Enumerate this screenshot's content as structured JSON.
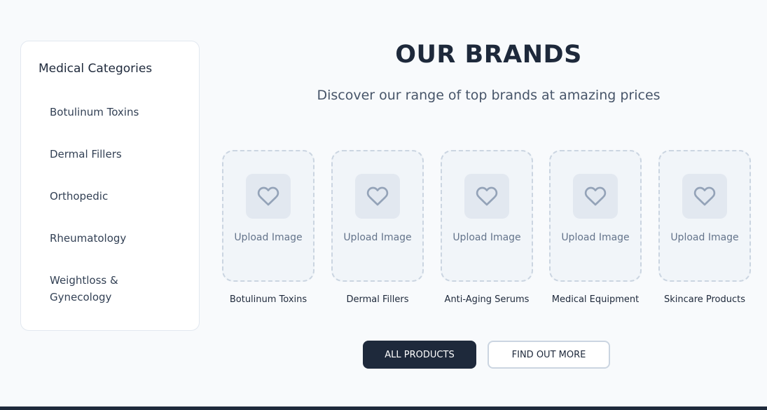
{
  "sidebar": {
    "title": "Medical Categories",
    "items": [
      {
        "label": "Botulinum Toxins"
      },
      {
        "label": "Dermal Fillers"
      },
      {
        "label": "Orthopedic"
      },
      {
        "label": "Rheumatology"
      },
      {
        "label": "Weightloss & Gynecology"
      }
    ]
  },
  "brands": {
    "title": "OUR BRANDS",
    "subtitle": "Discover our range of top brands at amazing prices",
    "upload_label": "Upload Image",
    "items": [
      {
        "name": "Botulinum Toxins",
        "icon": "heart-icon"
      },
      {
        "name": "Dermal Fillers",
        "icon": "heart-icon"
      },
      {
        "name": "Anti-Aging Serums",
        "icon": "heart-icon"
      },
      {
        "name": "Medical Equipment",
        "icon": "heart-icon"
      },
      {
        "name": "Skincare Products",
        "icon": "heart-icon"
      }
    ]
  },
  "actions": {
    "all_products": "ALL PRODUCTS",
    "find_out_more": "FIND OUT MORE"
  },
  "colors": {
    "primary": "#1e293b",
    "background": "#f8fafc",
    "icon": "#94a3b8"
  }
}
